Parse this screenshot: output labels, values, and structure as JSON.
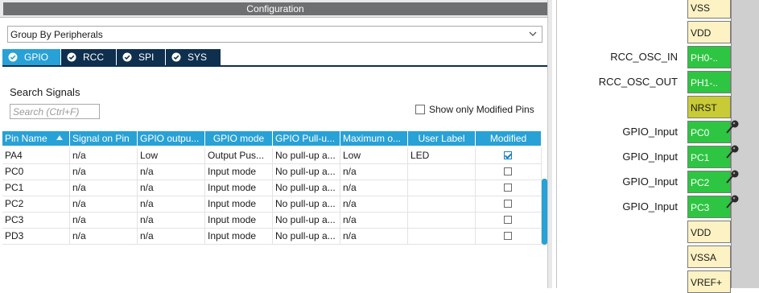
{
  "config": {
    "title": "Configuration",
    "group_by": "Group By Peripherals",
    "tabs": [
      {
        "label": "GPIO",
        "active": true
      },
      {
        "label": "RCC",
        "active": false
      },
      {
        "label": "SPI",
        "active": false
      },
      {
        "label": "SYS",
        "active": false
      }
    ],
    "search_label": "Search Signals",
    "search_placeholder": "Search (Ctrl+F)",
    "show_modified_label": "Show only Modified Pins",
    "columns": [
      "Pin Name",
      "Signal on Pin",
      "GPIO outpu...",
      "GPIO mode",
      "GPIO Pull-u...",
      "Maximum o...",
      "User Label",
      "Modified"
    ],
    "rows": [
      {
        "pin": "PA4",
        "signal": "n/a",
        "output": "Low",
        "mode": "Output Pus...",
        "pull": "No pull-up a...",
        "speed": "Low",
        "label": "LED",
        "modified": true
      },
      {
        "pin": "PC0",
        "signal": "n/a",
        "output": "n/a",
        "mode": "Input mode",
        "pull": "No pull-up a...",
        "speed": "n/a",
        "label": "",
        "modified": false
      },
      {
        "pin": "PC1",
        "signal": "n/a",
        "output": "n/a",
        "mode": "Input mode",
        "pull": "No pull-up a...",
        "speed": "n/a",
        "label": "",
        "modified": false
      },
      {
        "pin": "PC2",
        "signal": "n/a",
        "output": "n/a",
        "mode": "Input mode",
        "pull": "No pull-up a...",
        "speed": "n/a",
        "label": "",
        "modified": false
      },
      {
        "pin": "PC3",
        "signal": "n/a",
        "output": "n/a",
        "mode": "Input mode",
        "pull": "No pull-up a...",
        "speed": "n/a",
        "label": "",
        "modified": false
      },
      {
        "pin": "PD3",
        "signal": "n/a",
        "output": "n/a",
        "mode": "Input mode",
        "pull": "No pull-up a...",
        "speed": "n/a",
        "label": "",
        "modified": false
      }
    ]
  },
  "chip": {
    "pins": [
      {
        "name": "VSS",
        "type": "power",
        "label": ""
      },
      {
        "name": "VDD",
        "type": "power",
        "label": ""
      },
      {
        "name": "PH0-..",
        "type": "green",
        "label": "RCC_OSC_IN"
      },
      {
        "name": "PH1-..",
        "type": "green",
        "label": "RCC_OSC_OUT"
      },
      {
        "name": "NRST",
        "type": "olive",
        "label": ""
      },
      {
        "name": "PC0",
        "type": "green",
        "label": "GPIO_Input",
        "pinned": true
      },
      {
        "name": "PC1",
        "type": "green",
        "label": "GPIO_Input",
        "pinned": true
      },
      {
        "name": "PC2",
        "type": "green",
        "label": "GPIO_Input",
        "pinned": true
      },
      {
        "name": "PC3",
        "type": "green",
        "label": "GPIO_Input",
        "pinned": true
      },
      {
        "name": "VDD",
        "type": "power",
        "label": ""
      },
      {
        "name": "VSSA",
        "type": "power",
        "label": ""
      },
      {
        "name": "VREF+",
        "type": "power",
        "label": ""
      }
    ]
  },
  "colors": {
    "accent": "#28a1d6",
    "tab_dark": "#0e2f4e",
    "pin_green": "#2dc541",
    "pin_power": "#fdf2c4",
    "pin_olive": "#c8cb35"
  },
  "icons": {
    "tab": "check-circle-icon",
    "dropdown": "chevron-down-icon",
    "pin": "pushpin-icon",
    "sort": "sort-arrow-icon"
  }
}
